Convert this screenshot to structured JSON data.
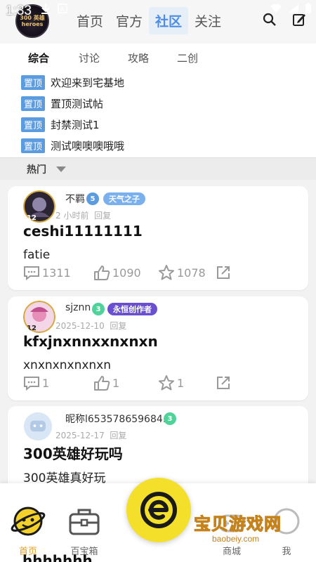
{
  "status": {
    "time": "1:33"
  },
  "logo": {
    "text": "300 英雄 heroes"
  },
  "nav": {
    "tabs": [
      {
        "label": "首页"
      },
      {
        "label": "官方"
      },
      {
        "label": "社区"
      },
      {
        "label": "关注"
      }
    ],
    "active_index": 2
  },
  "subtabs": [
    {
      "label": "综合"
    },
    {
      "label": "讨论"
    },
    {
      "label": "攻略"
    },
    {
      "label": "二创"
    }
  ],
  "pinned": {
    "badge": "置顶",
    "items": [
      {
        "title": "欢迎来到宅基地"
      },
      {
        "title": "置顶测试帖"
      },
      {
        "title": "封禁测试1"
      },
      {
        "title": "测试噢噢噢哦哦"
      }
    ]
  },
  "sort": {
    "label": "热门"
  },
  "posts": [
    {
      "author": "不羁",
      "level": "5",
      "level_color": "#5b9be0",
      "title_badge": "天气之子",
      "title_badge_color": "#7ab0ee",
      "meta_time": "2 小时前",
      "meta_reply": "回复",
      "title": "ceshi11111111",
      "body": "fatie",
      "comments": "1311",
      "likes": "1090",
      "stars": "1078"
    },
    {
      "author": "sjznn",
      "level": "3",
      "level_color": "#4fd39a",
      "title_badge": "永恒创作者",
      "title_badge_color": "#6a4fd0",
      "meta_time": "2025-12-10",
      "meta_reply": "回复",
      "title": "kfxjnxnnxxnxnxn",
      "body": "xnxnxnxnxnxn",
      "comments": "1",
      "likes": "1",
      "stars": "1"
    },
    {
      "author": "昵称l653578659684…",
      "level": "3",
      "level_color": "#4fd39a",
      "meta_time": "2025-12-17",
      "meta_reply": "回复",
      "title": "300英雄好玩吗",
      "body": "300英雄真好玩"
    }
  ],
  "next_post_partial": "hhhhhhh",
  "bottom_nav": [
    {
      "label": "首页",
      "icon": "planet-icon"
    },
    {
      "label": "百宝箱",
      "icon": "toolbox-icon"
    },
    {
      "label": "商城",
      "icon": "store-icon"
    },
    {
      "label": "我",
      "icon": "profile-icon"
    }
  ],
  "watermark": {
    "text": "宝贝游戏网",
    "url": "baobeiy.com"
  },
  "colors": {
    "accent": "#4b8de6",
    "pin_badge": "#5b9be0",
    "center_button": "#f4e02a",
    "active_nav": "#e89f1f"
  }
}
